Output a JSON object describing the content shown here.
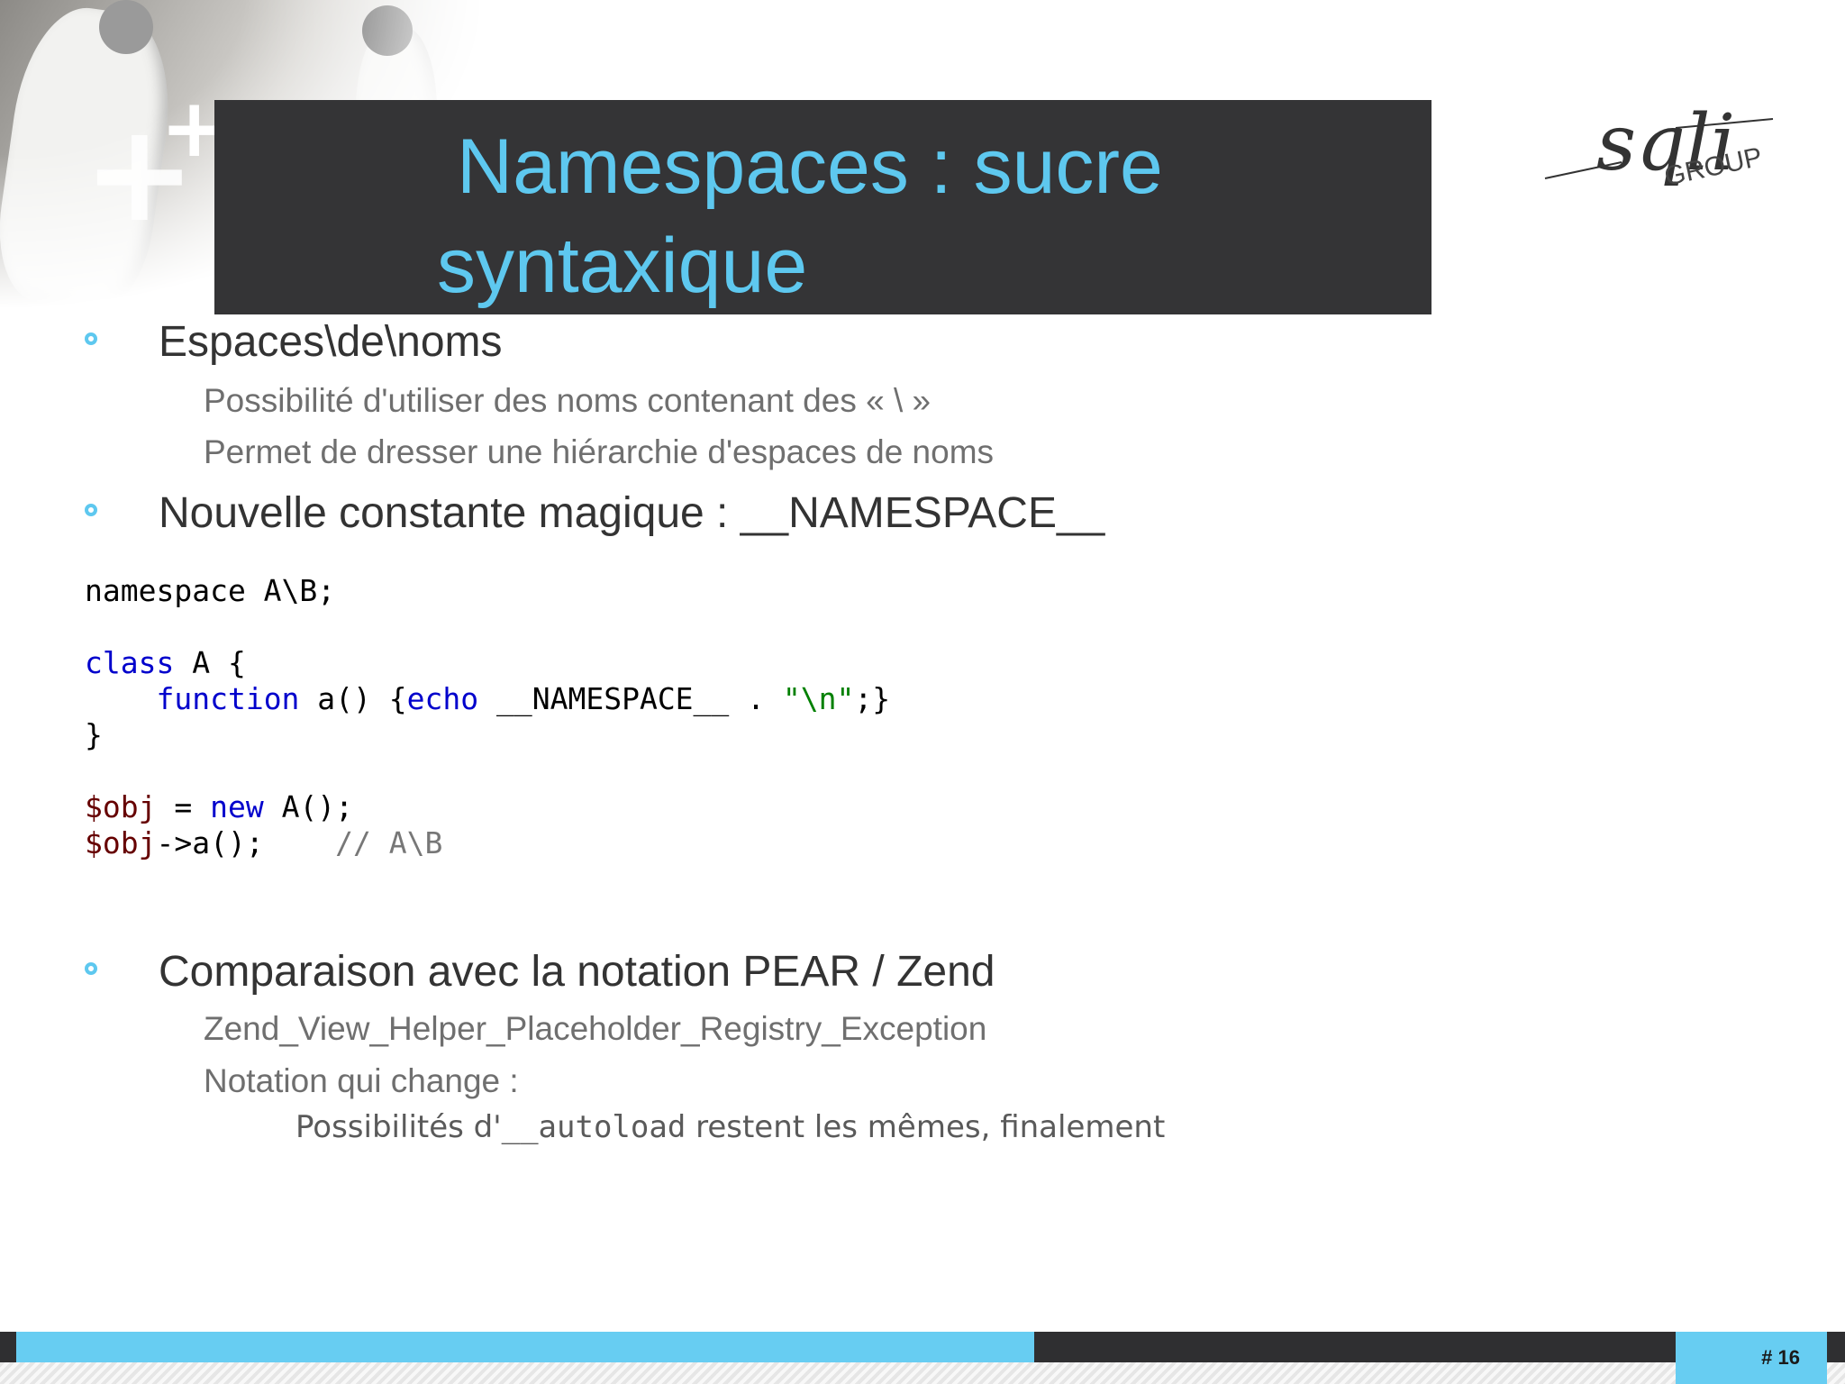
{
  "slide": {
    "title_line1": "Namespaces : sucre",
    "title_line2": "syntaxique",
    "logo_text_main": "sqli",
    "logo_text_sub": "GROUP",
    "page_number": "# 16"
  },
  "bullets": {
    "b1": {
      "text": "Espaces\\de\\noms",
      "sub1": "Possibilité d'utiliser des noms contenant des «  \\  »",
      "sub2": "Permet de dresser une hiérarchie d'espaces de noms"
    },
    "b2": {
      "text": "Nouvelle constante magique : __NAMESPACE__"
    },
    "b3": {
      "text": "Comparaison avec la notation PEAR / Zend",
      "sub1": "Zend_View_Helper_Placeholder_Registry_Exception",
      "sub2": "Notation qui change :",
      "sub3_prefix": "Possibilités d'",
      "sub3_code": "__autoload",
      "sub3_suffix": " restent les mêmes, finalement"
    }
  },
  "code": {
    "l1": "namespace A\\B;",
    "l3_kw": "class",
    "l3_rest": " A {",
    "l4_indent": "    ",
    "l4_kw": "function",
    "l4_mid": " a() {",
    "l4_echo": "echo",
    "l4_const": " __NAMESPACE__ . ",
    "l4_str": "\"\\n\"",
    "l4_end": ";}",
    "l5": "}",
    "l7_var": "$obj",
    "l7_eq": " = ",
    "l7_new": "new",
    "l7_rest": " A();",
    "l8_var": "$obj",
    "l8_rest": "->a();    ",
    "l8_cmt": "// A\\B"
  },
  "colors": {
    "accent": "#5ec8ef",
    "title_bar": "#343436",
    "keyword": "#0000cc",
    "string": "#008000",
    "variable": "#660000"
  }
}
